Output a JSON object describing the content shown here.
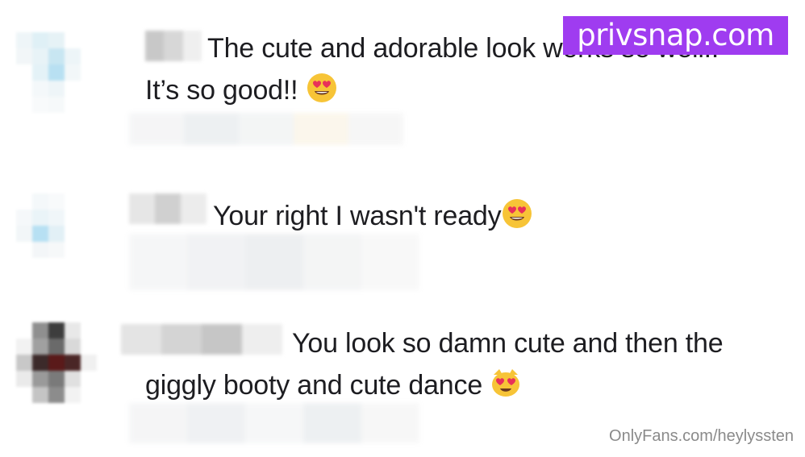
{
  "watermark": {
    "text": "privsnap.com",
    "color": "#9f3cf0"
  },
  "comments": [
    {
      "line1": "The cute and adorable look works so well!!",
      "line2": "It’s so good!!",
      "emoji": "heart-eyes-face-icon"
    },
    {
      "line1": "Your right I wasn't ready",
      "emoji": "heart-eyes-face-icon"
    },
    {
      "line1": "You look so damn cute and then the",
      "line2": "giggly booty and cute dance",
      "emoji": "heart-eyes-cat-icon"
    }
  ],
  "footer": {
    "text": "OnlyFans.com/heylyssten"
  }
}
